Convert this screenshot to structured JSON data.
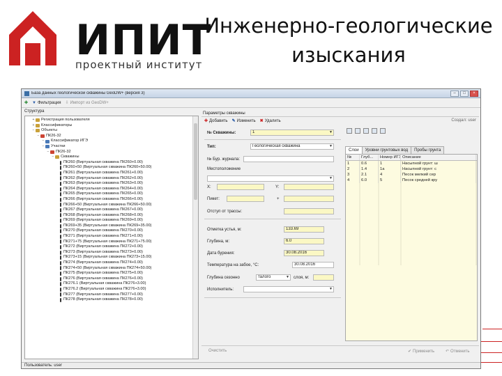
{
  "slide": {
    "logo_word": "ИПИТ",
    "logo_sub": "проектный институт",
    "title_line1": "Инженерно-геологические",
    "title_line2": "изыскания",
    "accent": "#cc2222"
  },
  "window": {
    "title": "База данных геологической скважины GeoDW+ (версия 3)"
  },
  "toolbar": {
    "filter_label": "Фильтрация",
    "import_label": "Импорт из GeoDW+"
  },
  "structure": {
    "label": "Структура",
    "rows": [
      "Регистрация пользователя",
      "Классификаторы",
      "Объекты",
      "ПК26-32",
      "Классификатор ИГЭ",
      "Участки",
      "ПК26-32",
      "Скважины",
      "ПК260 (Виртуальная скважина ПК260+0.00)",
      "ПК260+50 (Виртуальная скважина ПК260+50.00)",
      "ПК261 (Виртуальная скважина ПК261+0.00)",
      "ПК262 (Виртуальная скважина ПК262+0.00)",
      "ПК263 (Виртуальная скважина ПК263+0.00)",
      "ПК264 (Виртуальная скважина ПК264+0.00)",
      "ПК265 (Виртуальная скважина ПК265+0.00)",
      "ПК266 (Виртуальная скважина ПК266+0.00)",
      "ПК266+50 (Виртуальная скважина ПК266+50.00)",
      "ПК267 (Виртуальная скважина ПК267+0.00)",
      "ПК268 (Виртуальная скважина ПК268+0.00)",
      "ПК269 (Виртуальная скважина ПК269+0.00)",
      "ПК269+35 (Виртуальная скважина ПК269+35.00)",
      "ПК270 (Виртуальная скважина ПК270+0.00)",
      "ПК271 (Виртуальная скважина ПК271+0.00)",
      "ПК271+75 (Виртуальная скважина ПК271+75.00)",
      "ПК272 (Виртуальная скважина ПК272+0.00)",
      "ПК273 (Виртуальная скважина ПК273+0.00)",
      "ПК273+15 (Виртуальная скважина ПК273+15.00)",
      "ПК274 (Виртуальная скважина ПК274+0.00)",
      "ПК274+50 (Виртуальная скважина ПК274+50.00)",
      "ПК275 (Виртуальная скважина ПК275+0.00)",
      "ПК276 (Виртуальная скважина ПК276+0.00)",
      "ПК276.1 (Виртуальная скважина ПК276+3.00)",
      "ПК276.2 (Виртуальная скважина ПК276+3.00)",
      "ПК277 (Виртуальная скважина ПК277+0.00)",
      "ПК278 (Виртуальная скважина ПК278+0.00)"
    ]
  },
  "params": {
    "header": "Параметры скважины",
    "add_label": "Добавить",
    "edit_label": "Изменить",
    "delete_label": "Удалить",
    "user_label": "Создал: user",
    "well_no_label": "№ Скважины:",
    "well_no_value": "1",
    "type_label": "Тип:",
    "type_value": "Геологическая скважина",
    "journal_label": "№ Бур. журнала:",
    "location_title": "Местоположение",
    "x_label": "X:",
    "y_label": "Y:",
    "picket_label": "Пикет:",
    "plus_label": "+",
    "offset_label": "Отступ от трассы:",
    "mark_label": "Отметка устья, м:",
    "mark_value": "133.69",
    "depth_label": "Глубина, м:",
    "depth_value": "6.0",
    "date_label": "Дата бурения:",
    "date_value": "30.08.2016",
    "temp_label": "Температура на забое, °С:",
    "temp_value": "30.08.2016",
    "seasonal_label": "Глубина сезонно",
    "seasonal_value": "талого",
    "layer_label": "слоя, м:",
    "executor_label": "Исполнитель:",
    "clear_label": "Очистить",
    "apply_label": "Применить",
    "cancel_label": "Отменить"
  },
  "tabs": [
    "Слои",
    "Уровни грунтовых вод",
    "Пробы грунта"
  ],
  "layers": {
    "headers": [
      "№",
      "Глуб...",
      "Номер ИГЭ",
      "Описание"
    ],
    "rows": [
      [
        "1",
        "0.6",
        "1",
        "Насыпной грунт: ш"
      ],
      [
        "2",
        "1.4",
        "1а",
        "Насыпной грунт: с"
      ],
      [
        "3",
        "2.1",
        "4",
        "Песок мелкий сер"
      ],
      [
        "4",
        "6.0",
        "5",
        "Песок средней кру"
      ]
    ]
  },
  "status": {
    "text": "Пользователь: user"
  }
}
